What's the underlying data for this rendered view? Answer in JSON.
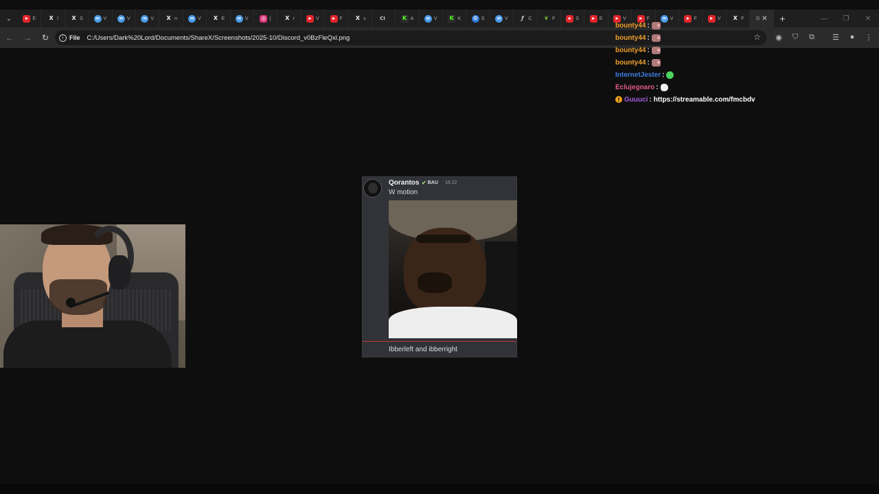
{
  "browser": {
    "tabs": [
      {
        "icon": "youtube-icon",
        "label": "E",
        "kind": "yt"
      },
      {
        "icon": "x-icon",
        "label": "I",
        "kind": "x"
      },
      {
        "icon": "x-icon",
        "label": "S",
        "kind": "x"
      },
      {
        "icon": "codex-icon",
        "label": "V",
        "kind": "cd"
      },
      {
        "icon": "codex-icon",
        "label": "V",
        "kind": "cd"
      },
      {
        "icon": "codex-icon",
        "label": "V",
        "kind": "cd"
      },
      {
        "icon": "x-icon",
        "label": "n",
        "kind": "x"
      },
      {
        "icon": "codex-icon",
        "label": "V",
        "kind": "cd"
      },
      {
        "icon": "x-icon",
        "label": "E",
        "kind": "x"
      },
      {
        "icon": "codex-icon",
        "label": "V",
        "kind": "cd"
      },
      {
        "icon": "instagram-icon",
        "label": "(",
        "kind": "ig"
      },
      {
        "icon": "x-icon",
        "label": "r",
        "kind": "x"
      },
      {
        "icon": "youtube-icon",
        "label": "V",
        "kind": "yt"
      },
      {
        "icon": "youtube-icon",
        "label": "F",
        "kind": "yt"
      },
      {
        "icon": "x-icon",
        "label": "c",
        "kind": "x"
      },
      {
        "icon": "clip-icon",
        "label": "",
        "kind": "cl"
      },
      {
        "icon": "kick-icon",
        "label": "A",
        "kind": "kk"
      },
      {
        "icon": "codex-icon",
        "label": "V",
        "kind": "cd"
      },
      {
        "icon": "kick-icon",
        "label": "K",
        "kind": "kk"
      },
      {
        "icon": "steam-icon",
        "label": "S",
        "kind": "st"
      },
      {
        "icon": "codex-icon",
        "label": "V",
        "kind": "cd"
      },
      {
        "icon": "function-icon",
        "label": "C",
        "kind": "fn"
      },
      {
        "icon": "leaf-icon",
        "label": "F",
        "kind": "lf"
      },
      {
        "icon": "youtube-icon",
        "label": "S",
        "kind": "yt"
      },
      {
        "icon": "youtube-icon",
        "label": "E",
        "kind": "yt"
      },
      {
        "icon": "youtube-icon",
        "label": "V",
        "kind": "yt"
      },
      {
        "icon": "youtube-icon",
        "label": "F",
        "kind": "yt"
      },
      {
        "icon": "codex-icon",
        "label": "V",
        "kind": "cd"
      },
      {
        "icon": "youtube-icon",
        "label": "F",
        "kind": "yt"
      },
      {
        "icon": "youtube-icon",
        "label": "V",
        "kind": "yt"
      },
      {
        "icon": "x-icon",
        "label": "F",
        "kind": "x"
      },
      {
        "icon": "",
        "label": "D",
        "kind": "active"
      }
    ],
    "address": {
      "scheme": "File",
      "url": "C:/Users/Dark%20Lord/Documents/ShareX/Screenshots/2025-10/Discord_v0BzFleQxl.png"
    }
  },
  "chat": {
    "lines": [
      {
        "user": "bounty44",
        "color": "#f0a02a",
        "emote": "pig-emote",
        "text": ""
      },
      {
        "user": "bounty44",
        "color": "#f0a02a",
        "emote": "pig-emote",
        "text": ""
      },
      {
        "user": "bounty44",
        "color": "#f0a02a",
        "emote": "pig-emote",
        "text": ""
      },
      {
        "user": "bounty44",
        "color": "#f0a02a",
        "emote": "pig-emote",
        "text": ""
      },
      {
        "user": "InternetJester",
        "color": "#3c7de0",
        "emote": "green-emote",
        "text": ""
      },
      {
        "user": "Eclujegnaro",
        "color": "#e05a8a",
        "emote": "fist-emote",
        "text": ""
      },
      {
        "user": "Guuuci",
        "color": "#a35fe0",
        "emote": "",
        "text": "https://streamable.com/fmcbdv",
        "badge": true
      }
    ]
  },
  "discord": {
    "username": "Qorantos",
    "role": "BAU",
    "timestamp": "16:22",
    "message": "W motion",
    "caption": "Ibberleft and ibberright"
  },
  "colors": {
    "page_bg": "#0e0e0e",
    "embed_bg": "#313338",
    "divider": "#c0393b"
  }
}
